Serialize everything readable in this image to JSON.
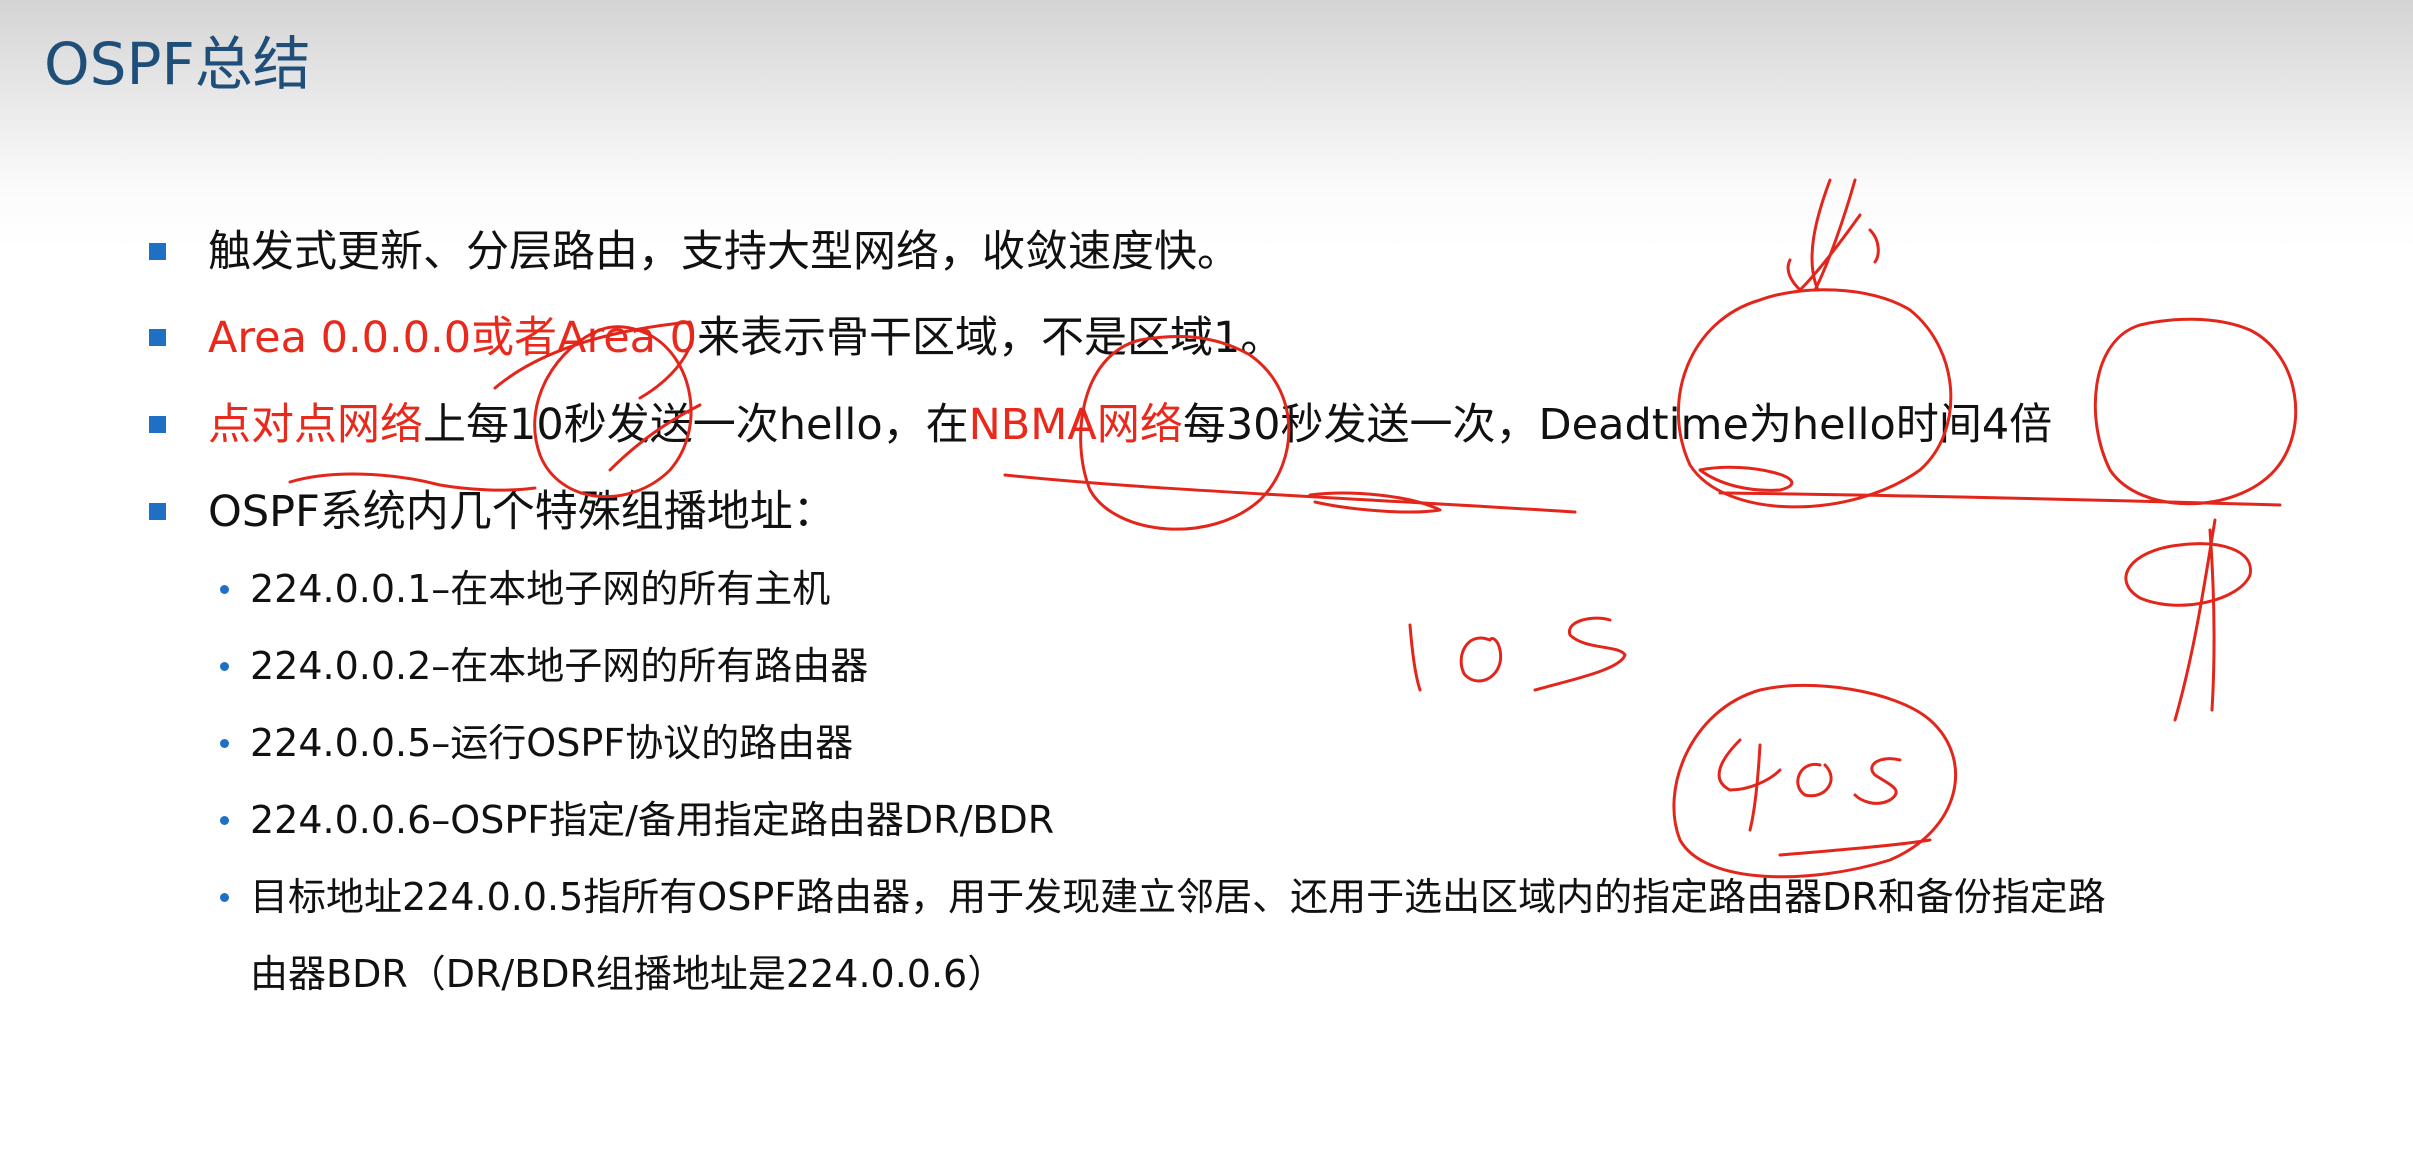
{
  "slide": {
    "title": "OSPF总结",
    "accent_color": "#1f6fc5",
    "title_color": "#1f4e79",
    "highlight_color": "#e8291c"
  },
  "bullets": [
    {
      "segments": [
        {
          "text": "触发式更新、分层路由，支持大型网络，收敛速度快。",
          "highlight": false
        }
      ]
    },
    {
      "segments": [
        {
          "text": "Area 0.0.0.0或者Area 0",
          "highlight": true
        },
        {
          "text": "来表示骨干区域，不是区域1。",
          "highlight": false
        }
      ]
    },
    {
      "segments": [
        {
          "text": "点对点网络",
          "highlight": true
        },
        {
          "text": "上每10秒发送一次hello，在",
          "highlight": false
        },
        {
          "text": "NBMA网络",
          "highlight": true
        },
        {
          "text": "每30秒发送一次，Deadtime为hello时间4倍",
          "highlight": false
        }
      ]
    },
    {
      "segments": [
        {
          "text": "OSPF系统内几个特殊组播地址：",
          "highlight": false
        }
      ]
    }
  ],
  "sub_bullets": [
    "224.0.0.1–在本地子网的所有主机",
    "224.0.0.2–在本地子网的所有路由器",
    "224.0.0.5–运行OSPF协议的路由器",
    "224.0.0.6–OSPF指定/备用指定路由器DR/BDR",
    "目标地址224.0.0.5指所有OSPF路由器，用于发现建立邻居、还用于选出区域内的指定路由器DR和备份指定路",
    "由器BDR（DR/BDR组播地址是224.0.0.6）"
  ],
  "annotations": {
    "ink_color": "#e3261b",
    "handwriting": [
      "10s",
      "40s"
    ]
  }
}
